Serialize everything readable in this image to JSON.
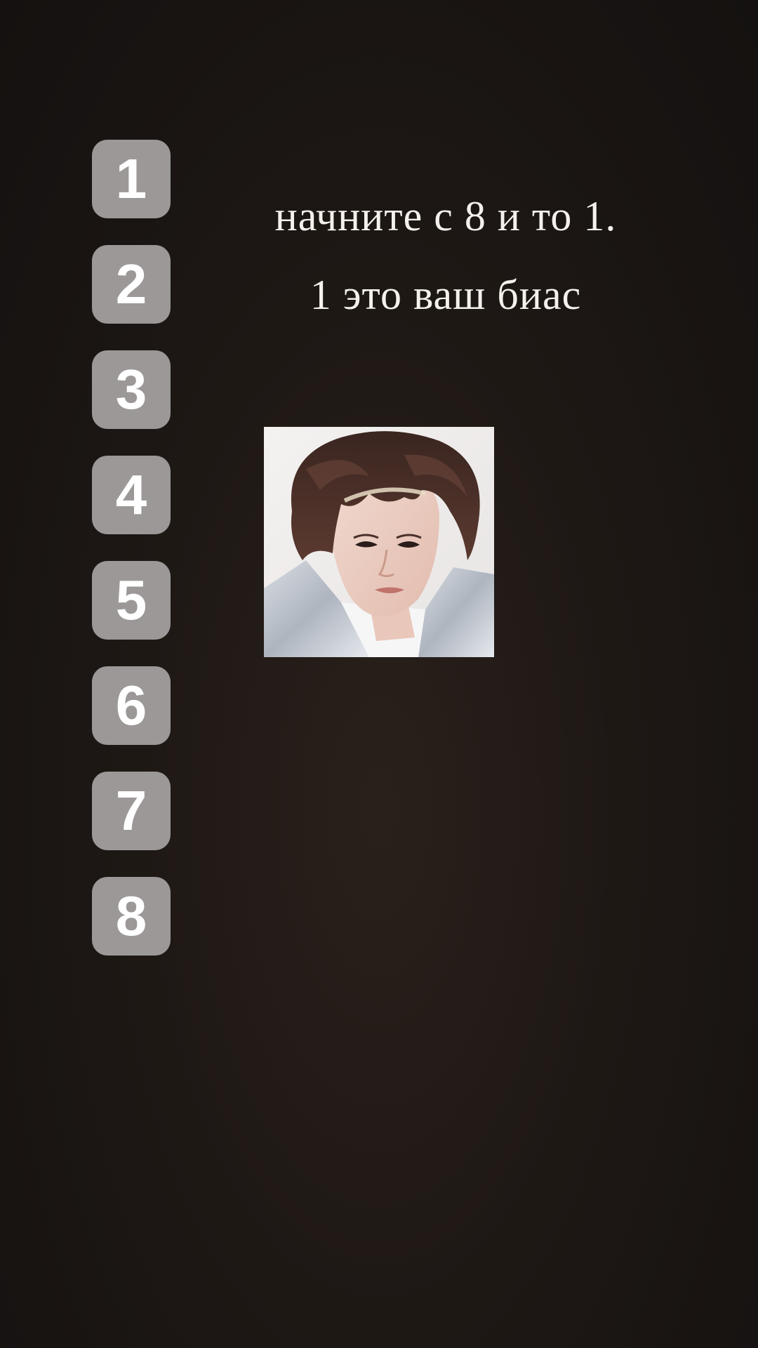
{
  "caption": {
    "line1": "начните с 8 и то 1.",
    "line2": "1 это ваш биас"
  },
  "ranks": [
    "1",
    "2",
    "3",
    "4",
    "5",
    "6",
    "7",
    "8"
  ],
  "photo": {
    "icon": "portrait-photo"
  },
  "colors": {
    "background": "#1e1815",
    "tile": "#9b9897",
    "tile_text": "#ffffff",
    "caption_text": "#f4f1ec"
  }
}
